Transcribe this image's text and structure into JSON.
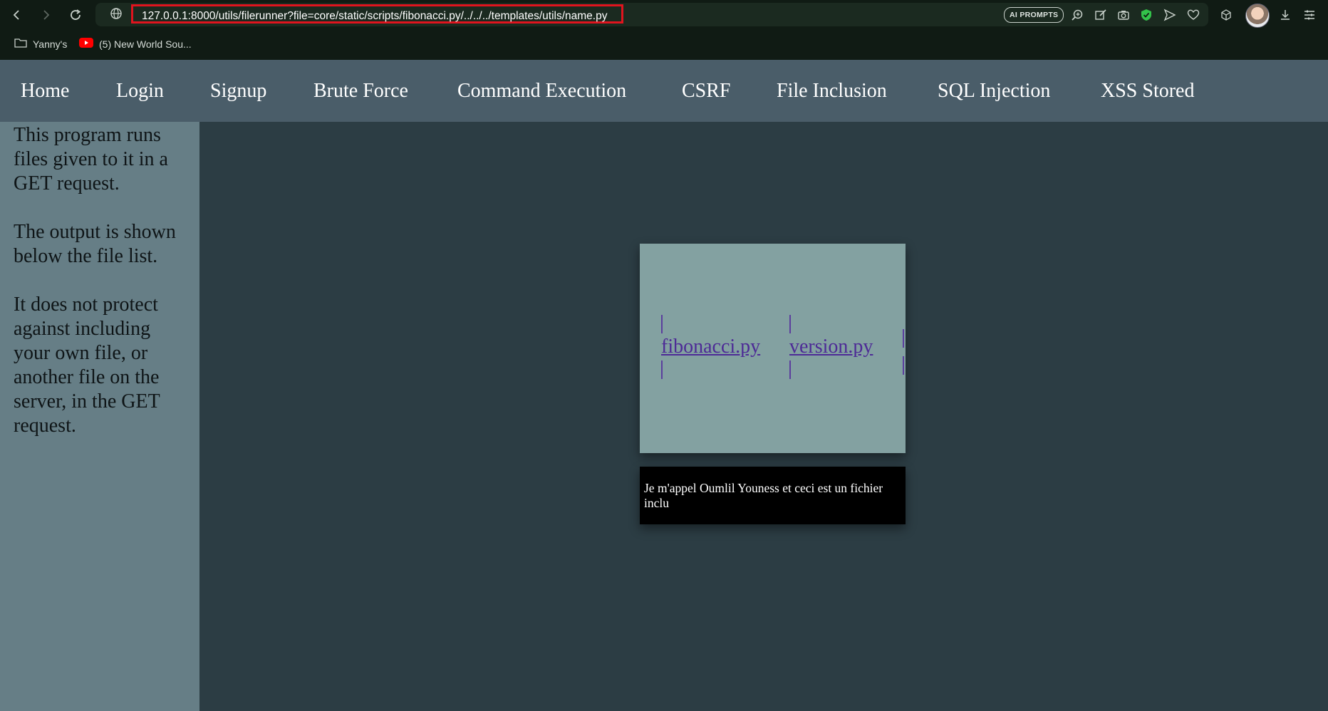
{
  "browser": {
    "url": "127.0.0.1:8000/utils/filerunner?file=core/static/scripts/fibonacci.py/../../../templates/utils/name.py",
    "ai_prompts_label": "AI PROMPTS",
    "bookmarks": [
      {
        "label": "Yanny's",
        "icon": "folder-icon"
      },
      {
        "label": "(5) New World Sou...",
        "icon": "youtube-icon"
      }
    ],
    "accent_color": "#e0141e"
  },
  "nav": {
    "items": [
      "Home",
      "Login",
      "Signup",
      "Brute Force",
      "Command Execution",
      "CSRF",
      "File Inclusion",
      "SQL Injection",
      "XSS Stored"
    ]
  },
  "sidebar": {
    "paragraphs": [
      "This program runs files given to it in a GET request.",
      "The output is shown below the file list.",
      "It does not protect against including your own file, or another file on the server, in the GET request."
    ]
  },
  "files": [
    "fibonacci.py",
    "version.py"
  ],
  "output": {
    "text": "Je m'appel Oumlil Youness et ceci est un fichier inclu"
  }
}
